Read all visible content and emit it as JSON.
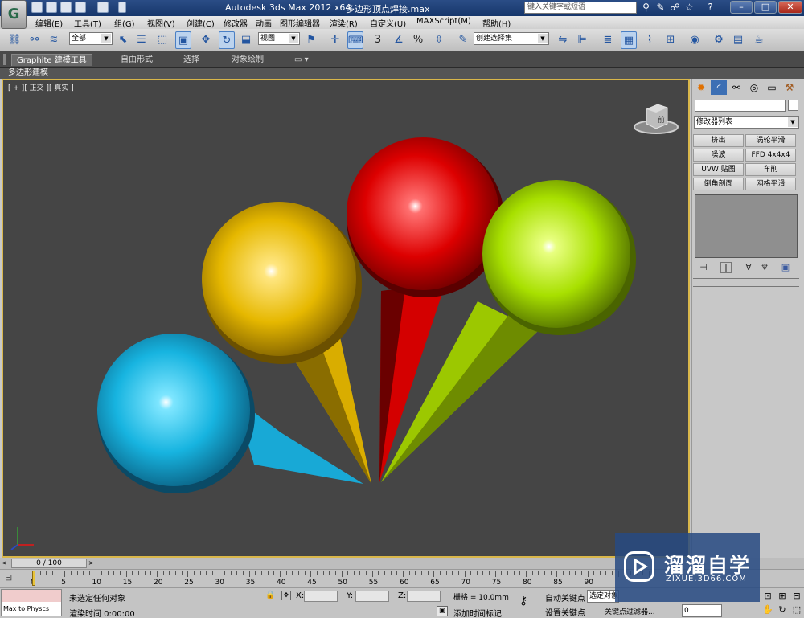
{
  "title_bar": {
    "app_title": "Autodesk 3ds Max  2012 x64",
    "file_name": "多边形顶点焊接.max",
    "search_placeholder": "键入关键字或短语",
    "logo_text": "G"
  },
  "menu": [
    "编辑(E)",
    "工具(T)",
    "组(G)",
    "视图(V)",
    "创建(C)",
    "修改器",
    "动画",
    "图形编辑器",
    "渲染(R)",
    "自定义(U)",
    "MAXScript(M)",
    "帮助(H)"
  ],
  "main_toolbar": {
    "selection_filter": "全部",
    "reference_coord": "视图",
    "snap_label": "3",
    "named_selection": "创建选择集",
    "percent_label": "%"
  },
  "ribbon": {
    "tabs": [
      "Graphite 建模工具",
      "自由形式",
      "选择",
      "对象绘制"
    ],
    "active_tab": "Graphite 建模工具",
    "sub_label": "多边形建模"
  },
  "viewport": {
    "label": "[ + ][ 正交 ][ 真实 ]",
    "viewcube_face": "前",
    "objects": [
      {
        "name": "cyan-cone-sphere",
        "color": "#1fb8e3"
      },
      {
        "name": "yellow-cone-sphere",
        "color": "#e6b800"
      },
      {
        "name": "red-cone-sphere",
        "color": "#e00000"
      },
      {
        "name": "lime-cone-sphere",
        "color": "#a8e000"
      }
    ]
  },
  "command_panel": {
    "modifier_list": "修改器列表",
    "modifier_buttons": [
      "挤出",
      "涡轮平滑",
      "噪波",
      "FFD 4x4x4",
      "UVW 贴图",
      "车削",
      "倒角剖面",
      "网格平滑"
    ]
  },
  "timeline": {
    "frame_display": "0 / 100",
    "current_frame": 0,
    "total_frames": 100,
    "tick_labels": [
      "0",
      "5",
      "10",
      "15",
      "20",
      "25",
      "30",
      "35",
      "40",
      "45",
      "50",
      "55",
      "60",
      "65",
      "70",
      "75",
      "80",
      "85",
      "90"
    ]
  },
  "status": {
    "maxscript_label": "Max to Physcs",
    "selection_status": "未选定任何对象",
    "render_time": "渲染时间  0:00:00",
    "x_label": "X:",
    "y_label": "Y:",
    "z_label": "Z:",
    "grid": "栅格 = 10.0mm",
    "add_time_tag": "添加时间标记",
    "auto_key": "自动关键点",
    "set_key": "设置关键点",
    "selected_dropdown": "选定对象",
    "key_filters": "关键点过滤器...",
    "frame_field": "0"
  },
  "watermark": {
    "title": "溜溜自学",
    "subtitle": "ZIXUE.3D66.COM"
  },
  "colors": {
    "viewport_bg": "#454545",
    "viewport_border": "#d9b74a",
    "title_bar": "#1f4178"
  }
}
